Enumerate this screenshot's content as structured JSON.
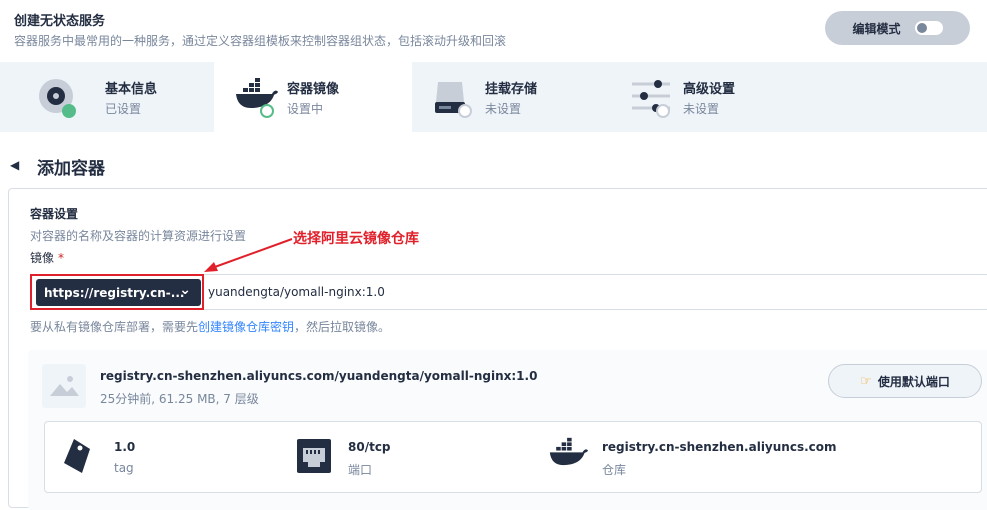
{
  "header": {
    "title": "创建无状态服务",
    "description": "容器服务中最常用的一种服务，通过定义容器组模板来控制容器组状态，包括滚动升级和回滚",
    "edit_mode_label": "编辑模式"
  },
  "steps": [
    {
      "label": "基本信息",
      "status": "已设置"
    },
    {
      "label": "容器镜像",
      "status": "设置中"
    },
    {
      "label": "挂载存储",
      "status": "未设置"
    },
    {
      "label": "高级设置",
      "status": "未设置"
    }
  ],
  "section_title": "添加容器",
  "container": {
    "title": "容器设置",
    "description": "对容器的名称及容器的计算资源进行设置",
    "image_label": "镜像",
    "required_mark": "*",
    "registry_value": "https://registry.cn-...",
    "image_value": "yuandengta/yomall-nginx:1.0",
    "hint_prefix": "要从私有镜像仓库部署，需要先",
    "hint_link": "创建镜像仓库密钥",
    "hint_suffix": "，然后拉取镜像。"
  },
  "annotation": "选择阿里云镜像仓库",
  "image_info": {
    "full_name": "registry.cn-shenzhen.aliyuncs.com/yuandengta/yomall-nginx:1.0",
    "meta": "25分钟前, 61.25 MB, 7 层级",
    "default_port_button": "使用默认端口"
  },
  "details": [
    {
      "value": "1.0",
      "key": "tag"
    },
    {
      "value": "80/tcp",
      "key": "端口"
    },
    {
      "value": "registry.cn-shenzhen.aliyuncs.com",
      "key": "仓库"
    }
  ],
  "colors": {
    "accent": "#55bc8a",
    "dark": "#242e42",
    "annotation": "#e0212b",
    "link": "#3385ff"
  }
}
